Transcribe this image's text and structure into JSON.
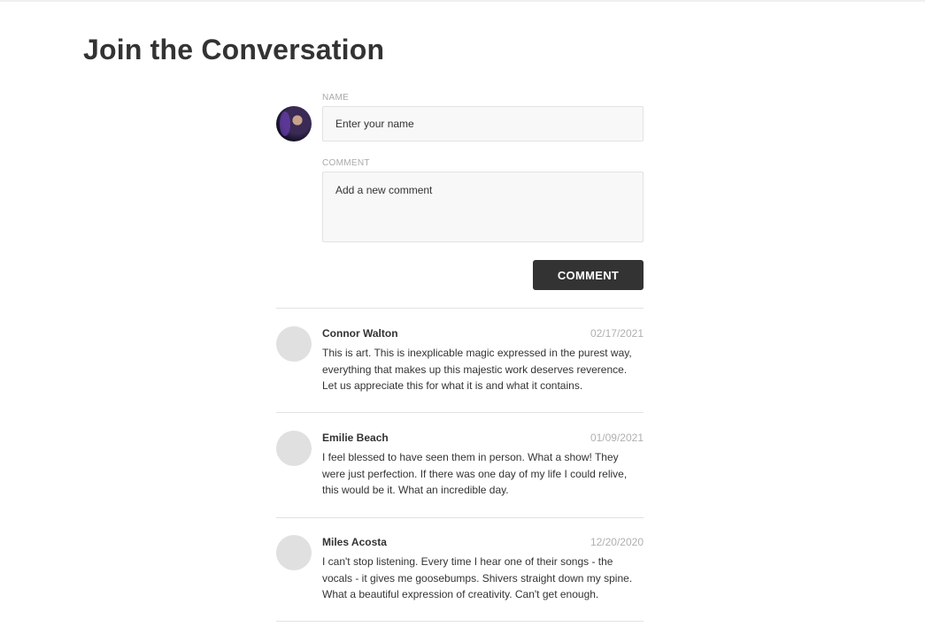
{
  "page": {
    "title": "Join the Conversation"
  },
  "form": {
    "name_label": "NAME",
    "name_placeholder": "Enter your name",
    "comment_label": "COMMENT",
    "comment_placeholder": "Add a new comment",
    "submit_label": "COMMENT",
    "user_avatar_icon": "user-avatar-photo"
  },
  "comments": [
    {
      "author": "Connor Walton",
      "date": "02/17/2021",
      "text": "This is art. This is inexplicable magic expressed in the purest way, everything that makes up this majestic work deserves reverence. Let us appreciate this for what it is and what it contains."
    },
    {
      "author": "Emilie Beach",
      "date": "01/09/2021",
      "text": "I feel blessed to have seen them in person. What a show! They were just perfection. If there was one day of my life I could relive, this would be it. What an incredible day."
    },
    {
      "author": "Miles Acosta",
      "date": "12/20/2020",
      "text": "I can't stop listening. Every time I hear one of their songs - the vocals - it gives me goosebumps. Shivers straight down my spine. What a beautiful expression of creativity. Can't get enough."
    }
  ],
  "colors": {
    "text": "#333333",
    "muted": "#aaaaaa",
    "button_bg": "#333333",
    "input_bg": "#f8f8f8",
    "divider": "#e2e2e2"
  }
}
